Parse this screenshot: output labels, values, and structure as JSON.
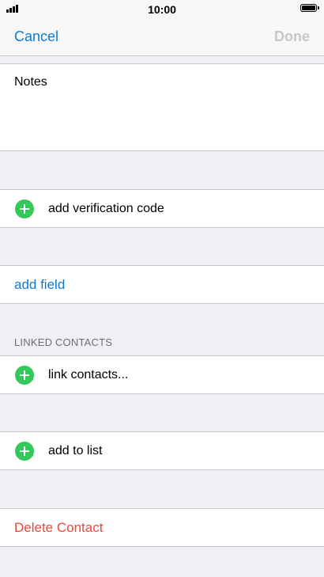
{
  "status_bar": {
    "time": "10:00"
  },
  "nav": {
    "cancel_label": "Cancel",
    "done_label": "Done"
  },
  "notes": {
    "label": "Notes"
  },
  "rows": {
    "add_verification_code": "add verification code",
    "add_field": "add field",
    "linked_contacts_header": "LINKED CONTACTS",
    "link_contacts": "link contacts...",
    "add_to_list": "add to list",
    "delete_contact": "Delete Contact"
  },
  "colors": {
    "accent": "#0a7cd6",
    "add_icon": "#34c759",
    "destructive": "#f0453a",
    "background": "#efeff4"
  }
}
